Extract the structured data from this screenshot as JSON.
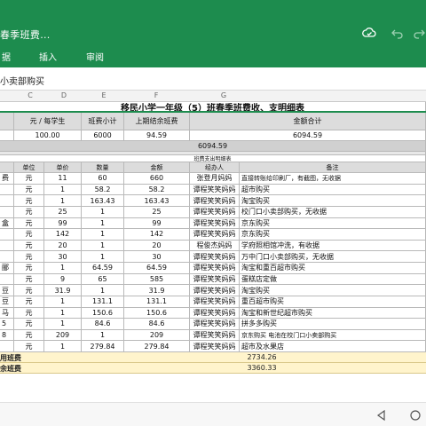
{
  "app": {
    "title": "春季班费..."
  },
  "menu": {
    "items": [
      "据",
      "插入",
      "审阅"
    ]
  },
  "formula_bar": {
    "content": "小卖部购买"
  },
  "columns": [
    "C",
    "D",
    "E",
    "F",
    "G"
  ],
  "sheet": {
    "main_title": "移民小学一年级（5）班春季班费收、支明细表",
    "summary_headers": [
      "元 / 每学生",
      "班费小计",
      "上期结余班费",
      "金额合计"
    ],
    "summary_values": [
      "100.00",
      "6000",
      "94.59",
      "6094.59"
    ],
    "total_row_value": "6094.59",
    "detail_title": "班费支出明细表",
    "detail_headers": [
      "单位",
      "单价",
      "数量",
      "金额",
      "经办人",
      "备注"
    ],
    "rows": [
      {
        "name": "费",
        "unit": "元",
        "price": "11",
        "qty": "60",
        "amount": "660",
        "handler": "张登月妈妈",
        "note": "直接转账给印刷厂，有截图，无收据"
      },
      {
        "name": "",
        "unit": "元",
        "price": "1",
        "qty": "58.2",
        "amount": "58.2",
        "handler": "谭程笑笑妈妈",
        "note": "超市购买"
      },
      {
        "name": "",
        "unit": "元",
        "price": "1",
        "qty": "163.43",
        "amount": "163.43",
        "handler": "谭程笑笑妈妈",
        "note": "淘宝购买"
      },
      {
        "name": "",
        "unit": "元",
        "price": "25",
        "qty": "1",
        "amount": "25",
        "handler": "谭程笑笑妈妈",
        "note": "校门口小卖部购买，无收据"
      },
      {
        "name": "盒",
        "unit": "元",
        "price": "99",
        "qty": "1",
        "amount": "99",
        "handler": "谭程笑笑妈妈",
        "note": "京东购买"
      },
      {
        "name": "",
        "unit": "元",
        "price": "142",
        "qty": "1",
        "amount": "142",
        "handler": "谭程笑笑妈妈",
        "note": "京东购买"
      },
      {
        "name": "",
        "unit": "元",
        "price": "20",
        "qty": "1",
        "amount": "20",
        "handler": "程俊杰妈妈",
        "note": "学府照相馆冲洗，有收据"
      },
      {
        "name": "",
        "unit": "元",
        "price": "30",
        "qty": "1",
        "amount": "30",
        "handler": "谭程笑笑妈妈",
        "note": "万中门口小卖部购买，无收据"
      },
      {
        "name": "郦",
        "unit": "元",
        "price": "1",
        "qty": "64.59",
        "amount": "64.59",
        "handler": "谭程笑笑妈妈",
        "note": "淘宝和重百超市购买"
      },
      {
        "name": "",
        "unit": "元",
        "price": "9",
        "qty": "65",
        "amount": "585",
        "handler": "谭程笑笑妈妈",
        "note": "蛋糕店定做"
      },
      {
        "name": "豆",
        "unit": "元",
        "price": "31.9",
        "qty": "1",
        "amount": "31.9",
        "handler": "谭程笑笑妈妈",
        "note": "淘宝购买"
      },
      {
        "name": "豆",
        "unit": "元",
        "price": "1",
        "qty": "131.1",
        "amount": "131.1",
        "handler": "谭程笑笑妈妈",
        "note": "重百超市购买"
      },
      {
        "name": "马",
        "unit": "元",
        "price": "1",
        "qty": "150.6",
        "amount": "150.6",
        "handler": "谭程笑笑妈妈",
        "note": "淘宝和新世纪超市购买"
      },
      {
        "name": "5",
        "unit": "元",
        "price": "1",
        "qty": "84.6",
        "amount": "84.6",
        "handler": "谭程笑笑妈妈",
        "note": "拼多多购买"
      },
      {
        "name": "8",
        "unit": "元",
        "price": "209",
        "qty": "1",
        "amount": "209",
        "handler": "谭程笑笑妈妈",
        "note": "京东购买 电池在校门口小卖部购买"
      },
      {
        "name": "",
        "unit": "元",
        "price": "1",
        "qty": "279.84",
        "amount": "279.84",
        "handler": "谭程笑笑妈妈",
        "note": "超市及水果店"
      }
    ],
    "totals": [
      {
        "label": "用班费",
        "value": "2734.26"
      },
      {
        "label": "余班费",
        "value": "3360.33"
      }
    ]
  },
  "colors": {
    "brand_green": "#1d8c4e",
    "totals_bg": "#fff4cc",
    "header_gray": "#dcdcdc"
  }
}
